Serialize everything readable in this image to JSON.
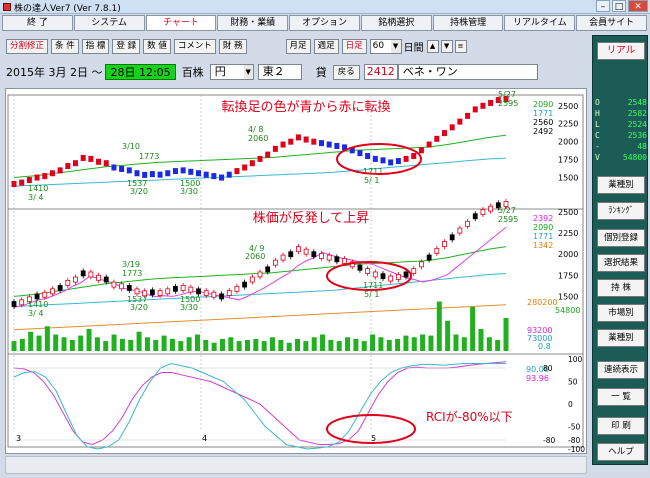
{
  "window": {
    "title": "株の達人Ver7 (Ver 7.8.1)"
  },
  "menu": [
    {
      "label": "終 了",
      "active": false
    },
    {
      "label": "システム",
      "active": false
    },
    {
      "label": "チャート",
      "active": true
    },
    {
      "label": "財務・業績",
      "active": false
    },
    {
      "label": "オプション",
      "active": false
    },
    {
      "label": "銘柄選択",
      "active": false
    },
    {
      "label": "持株管理",
      "active": false
    },
    {
      "label": "リアルタイム",
      "active": false
    },
    {
      "label": "会員サイト",
      "active": false
    }
  ],
  "toolbar": {
    "buttons": [
      {
        "label": "分割修正",
        "red": true
      },
      {
        "label": "条 件",
        "red": false
      },
      {
        "label": "指 標",
        "red": false
      },
      {
        "label": "登 録",
        "red": false
      },
      {
        "label": "数 値",
        "red": false
      },
      {
        "label": "コメント",
        "red": false
      },
      {
        "label": "財 務",
        "red": false
      }
    ],
    "period_buttons": [
      {
        "label": "月足",
        "red": false
      },
      {
        "label": "週足",
        "red": false
      },
      {
        "label": "日足",
        "red": true
      }
    ],
    "count": "60",
    "count_unit": "日間",
    "nav": [
      "▲",
      "▼",
      "≡"
    ]
  },
  "datebar": {
    "date": "2015年 3月 2日 ～",
    "end": "28日 12:05",
    "units": "百株",
    "currency": "円",
    "market": "東２",
    "lending": "貸",
    "back_label": "戻る",
    "code": "2412",
    "name": "ベネ・ワン"
  },
  "chart_data": {
    "type": "line",
    "candles_price": [
      1410,
      1430,
      1465,
      1500,
      1520,
      1560,
      1600,
      1660,
      1700,
      1773,
      1760,
      1720,
      1700,
      1640,
      1620,
      1600,
      1560,
      1537,
      1548,
      1540,
      1560,
      1590,
      1600,
      1580,
      1560,
      1540,
      1520,
      1500,
      1540,
      1590,
      1640,
      1700,
      1760,
      1820,
      1900,
      1960,
      2000,
      2060,
      2030,
      2000,
      1980,
      1960,
      1940,
      1920,
      1880,
      1840,
      1800,
      1760,
      1740,
      1711,
      1730,
      1760,
      1800,
      1880,
      1960,
      2040,
      2120,
      2200,
      2280,
      2360,
      2450,
      2500,
      2540,
      2580,
      2595
    ],
    "ma_green": [
      1500,
      1510,
      1520,
      1530,
      1545,
      1560,
      1575,
      1590,
      1605,
      1620,
      1635,
      1650,
      1660,
      1670,
      1680,
      1690,
      1700,
      1710,
      1715,
      1720,
      1725,
      1730,
      1735,
      1740,
      1745,
      1750,
      1755,
      1760,
      1765,
      1770,
      1775,
      1780,
      1790,
      1800,
      1810,
      1820,
      1830,
      1840,
      1850,
      1860,
      1870,
      1880,
      1885,
      1890,
      1895,
      1900,
      1905,
      1910,
      1915,
      1920,
      1930,
      1945,
      1960,
      1980,
      2000,
      2020,
      2040,
      2060,
      2075,
      2090
    ],
    "ma_teal": [
      1380,
      1385,
      1390,
      1395,
      1400,
      1405,
      1410,
      1415,
      1420,
      1425,
      1430,
      1435,
      1440,
      1445,
      1450,
      1455,
      1460,
      1465,
      1470,
      1475,
      1480,
      1485,
      1490,
      1495,
      1500,
      1505,
      1510,
      1515,
      1520,
      1525,
      1530,
      1535,
      1540,
      1545,
      1550,
      1555,
      1560,
      1565,
      1570,
      1580,
      1590,
      1600,
      1610,
      1620,
      1630,
      1640,
      1650,
      1660,
      1670,
      1680,
      1690,
      1700,
      1710,
      1720,
      1730,
      1740,
      1750,
      1760,
      1765,
      1771
    ],
    "annotations_top": [
      {
        "label": "3/10",
        "value": "1773"
      },
      {
        "label": "4/ 8",
        "value": "2060"
      },
      {
        "label": "1537",
        "value": "3/20"
      },
      {
        "label": "1500",
        "value": "3/30"
      },
      {
        "label": "1410",
        "value": "3/ 4"
      },
      {
        "label": "1711",
        "value": "5/ 1"
      },
      {
        "label": "5/27",
        "value": "2595"
      }
    ],
    "annotations_mid": [
      {
        "label": "3/19",
        "value": "1773"
      },
      {
        "label": "4/ 9",
        "value": "2060"
      },
      {
        "label": "1537",
        "value": "3/20"
      },
      {
        "label": "1500",
        "value": "3/30"
      },
      {
        "label": "1410",
        "value": "3/ 4"
      },
      {
        "label": "1711",
        "value": "5/ 1"
      },
      {
        "label": "5/27",
        "value": "2595"
      }
    ],
    "top_axis": [
      "2500",
      "2250",
      "2000",
      "1750",
      "1500"
    ],
    "top_axis_vals": [
      2500,
      2250,
      2000,
      1750,
      1500
    ],
    "top_ma_labels": [
      {
        "text": "2090",
        "color": "#16a81a"
      },
      {
        "text": "1771",
        "color": "#20a0c0"
      },
      {
        "text": "2560",
        "color": "#000000"
      },
      {
        "text": "2492",
        "color": "#000000"
      }
    ],
    "mid_axis": [
      "2500",
      "2250",
      "2000",
      "1750",
      "1500"
    ],
    "mid_ma_labels": [
      {
        "text": "2392",
        "color": "#e020e0"
      },
      {
        "text": "2090",
        "color": "#16a81a"
      },
      {
        "text": "1771",
        "color": "#20a0c0"
      },
      {
        "text": "1342",
        "color": "#e08010"
      }
    ],
    "volume": [
      18,
      22,
      35,
      28,
      45,
      30,
      25,
      20,
      28,
      40,
      25,
      18,
      30,
      22,
      20,
      35,
      25,
      20,
      28,
      22,
      18,
      25,
      30,
      20,
      15,
      22,
      25,
      18,
      20,
      22,
      18,
      25,
      20,
      15,
      22,
      18,
      25,
      30,
      20,
      18,
      25,
      22,
      18,
      30,
      25,
      20,
      22,
      28,
      25,
      30,
      28,
      90,
      55,
      30,
      25,
      80,
      40,
      25,
      20,
      60
    ],
    "volume_labels": [
      {
        "text": "280200",
        "color": "#e08010"
      },
      {
        "text": "54800",
        "color": "#16a81a"
      },
      {
        "text": "93200",
        "color": "#e020e0"
      },
      {
        "text": "73000",
        "color": "#20a0c0"
      },
      {
        "text": "0.8",
        "color": "#20a0c0"
      }
    ],
    "rci_pink": [
      80,
      78,
      70,
      50,
      20,
      -20,
      -60,
      -85,
      -90,
      -80,
      -60,
      -30,
      10,
      40,
      60,
      70,
      70,
      65,
      60,
      55,
      50,
      40,
      30,
      20,
      10,
      0,
      -20,
      -40,
      -60,
      -80,
      -85,
      -90,
      -90,
      -88,
      -80,
      -60,
      -20,
      20,
      50,
      70,
      80,
      82,
      80,
      80,
      80,
      82,
      85,
      88,
      90,
      92,
      93.96
    ],
    "rci_cyan": [
      60,
      70,
      72,
      60,
      30,
      -20,
      -70,
      -95,
      -100,
      -95,
      -80,
      -40,
      10,
      50,
      80,
      90,
      85,
      80,
      70,
      60,
      50,
      30,
      10,
      -20,
      -50,
      -70,
      -90,
      -95,
      -100,
      -98,
      -95,
      -85,
      -60,
      -20,
      20,
      50,
      70,
      80,
      85,
      88,
      88,
      86,
      88,
      90,
      90,
      90,
      90,
      90
    ],
    "rci_axis": [
      "100",
      "50",
      "0",
      "-50",
      "-80",
      "-100"
    ],
    "rci_axis_vals": [
      100,
      50,
      0,
      -50,
      -80,
      -100
    ],
    "rci_values": [
      {
        "text": "90.00",
        "color": "#20a0c0"
      },
      {
        "text": "93.96",
        "color": "#e020e0"
      }
    ],
    "rci_extra_axis": [
      "80",
      "-80"
    ],
    "months": [
      "3",
      "4",
      "5"
    ]
  },
  "callouts": {
    "top": "転換足の色が青から赤に転換",
    "mid": "株価が反発して上昇",
    "rci": "RCIが-80%以下"
  },
  "rightpanel": {
    "real_label": "リアル",
    "quote": [
      {
        "k": "O",
        "v": "2548"
      },
      {
        "k": "H",
        "v": "2582"
      },
      {
        "k": "L",
        "v": "2524"
      },
      {
        "k": "C",
        "v": "2536"
      },
      {
        "k": "-",
        "v": "48"
      },
      {
        "k": "V",
        "v": "54800"
      }
    ],
    "buttons": [
      "業種別",
      "ﾗﾝｷﾝｸﾞ",
      "個別登録",
      "選択結果",
      "持 株",
      "市場別",
      "業種別"
    ],
    "buttons2": [
      "連続表示",
      "一 覧",
      "印 刷",
      "ヘルプ"
    ]
  }
}
